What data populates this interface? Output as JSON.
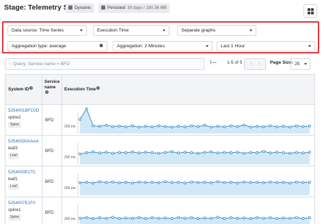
{
  "header": {
    "title": "Stage: Telemetry Stats",
    "chip_dynamic": "Dynamic",
    "chip_persisted": "Persisted",
    "chip_persisted_detail": "30 days / 190.36 MB",
    "layout_icon": "grid-layout-icon"
  },
  "filters": {
    "data_source": "Data source: Time Series",
    "field": "Execution Time",
    "graphs": "Separate graphs",
    "aggregation_type": "Aggregation type: average",
    "aggregation_type_clear": "✖",
    "aggregation": "Aggregation: 2 Minutes",
    "time_range": "Last 1 Hour"
  },
  "query": {
    "text": "Query: Service name = BFD"
  },
  "pager": {
    "expand": "⟩—",
    "count": "1-5 of 5",
    "prev": "‹",
    "next": "›",
    "page_size_label": "Page Size:",
    "page_size": "25"
  },
  "table": {
    "columns": {
      "system_id": "System ID",
      "service": "Service name",
      "exec": "Execution Time"
    },
    "rows": [
      {
        "system_id": "5254001BFC0D",
        "host": "spine2",
        "role": "Spine",
        "service": "BFD",
        "axis": "200 ms",
        "values": [
          0.55,
          0.95,
          0.3,
          0.28,
          0.32,
          0.27,
          0.29,
          0.26,
          0.3,
          0.25,
          0.28,
          0.26,
          0.3,
          0.27,
          0.25,
          0.28,
          0.26,
          0.3,
          0.27,
          0.32,
          0.25,
          0.28,
          0.26,
          0.3,
          0.27,
          0.33,
          0.25,
          0.28,
          0.26,
          0.3,
          0.26,
          0.28,
          0.25,
          0.3,
          0.27,
          0.29
        ]
      },
      {
        "system_id": "52540030AAAA",
        "host": "leaf3",
        "role": "Leaf",
        "service": "BFD",
        "axis": "200 ms",
        "values": [
          0.4,
          0.45,
          0.48,
          0.44,
          0.47,
          0.43,
          0.46,
          0.45,
          0.48,
          0.44,
          0.47,
          0.45,
          0.43,
          0.46,
          0.49,
          0.44,
          0.47,
          0.45,
          0.43,
          0.46,
          0.48,
          0.44,
          0.46,
          0.45,
          0.47,
          0.43,
          0.46,
          0.45,
          0.5,
          0.44,
          0.47,
          0.45,
          0.43,
          0.46,
          0.44,
          0.47
        ]
      },
      {
        "system_id": "5254003E27C",
        "host": "leaf1",
        "role": "Leaf",
        "service": "BFD",
        "axis": "200 ms",
        "values": [
          0.48,
          0.5,
          0.47,
          0.52,
          0.49,
          0.51,
          0.48,
          0.5,
          0.47,
          0.51,
          0.49,
          0.5,
          0.48,
          0.52,
          0.49,
          0.5,
          0.47,
          0.51,
          0.49,
          0.5,
          0.48,
          0.52,
          0.49,
          0.5,
          0.47,
          0.51,
          0.49,
          0.5,
          0.48,
          0.51,
          0.49,
          0.5,
          0.47,
          0.51,
          0.49,
          0.5
        ]
      },
      {
        "system_id": "5254007E1F0",
        "host": "spine1",
        "role": "Spine",
        "service": "BFD",
        "axis": "200 ms",
        "values": [
          0.3,
          0.33,
          0.29,
          0.32,
          0.3,
          0.34,
          0.29,
          0.31,
          0.3,
          0.33,
          0.29,
          0.32,
          0.3,
          0.31,
          0.29,
          0.33,
          0.3,
          0.32,
          0.29,
          0.31,
          0.3,
          0.34,
          0.29,
          0.32,
          0.3,
          0.31,
          0.29,
          0.33,
          0.3,
          0.32,
          0.29,
          0.31,
          0.3,
          0.33,
          0.29,
          0.32
        ]
      }
    ]
  },
  "colors": {
    "highlight_border": "#e03034",
    "link": "#2f6fb3",
    "series_line": "#2a85c7",
    "series_fill": "#d3e8f6"
  }
}
